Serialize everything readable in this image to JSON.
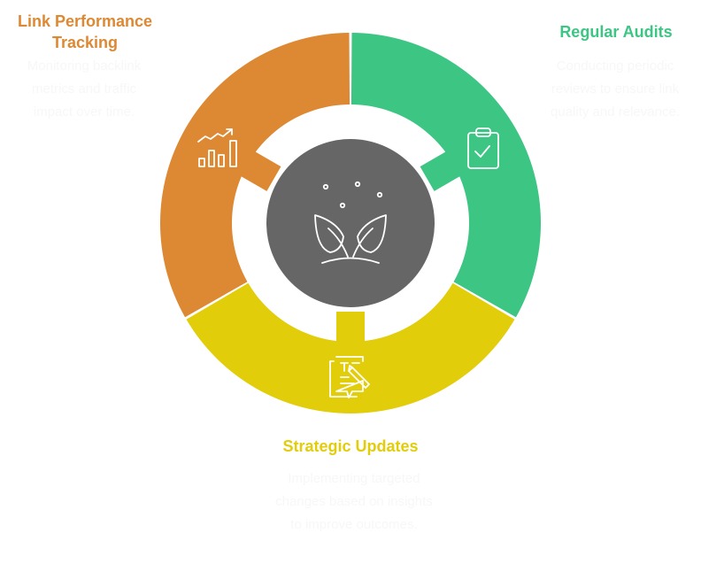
{
  "colors": {
    "performance": "#DD8833",
    "audits": "#3DC584",
    "updates": "#E2CD0A",
    "center": "#666666",
    "icon": "#ffffff"
  },
  "center": {
    "icon": "sprouting-plant-icon"
  },
  "segments": [
    {
      "id": "performance",
      "title": "Link Performance Tracking",
      "title_lines": [
        "Link Performance",
        "Tracking"
      ],
      "description": "Monitoring backlink metrics and traffic impact over time.",
      "icon": "growth-chart-icon"
    },
    {
      "id": "audits",
      "title": "Regular Audits",
      "title_lines": [
        "Regular Audits"
      ],
      "description": "Conducting periodic reviews to ensure link quality and relevance.",
      "icon": "clipboard-check-icon"
    },
    {
      "id": "updates",
      "title": "Strategic Updates",
      "title_lines": [
        "Strategic Updates"
      ],
      "description": "Implementing targeted changes based on insights to improve outcomes.",
      "icon": "document-edit-icon"
    }
  ]
}
